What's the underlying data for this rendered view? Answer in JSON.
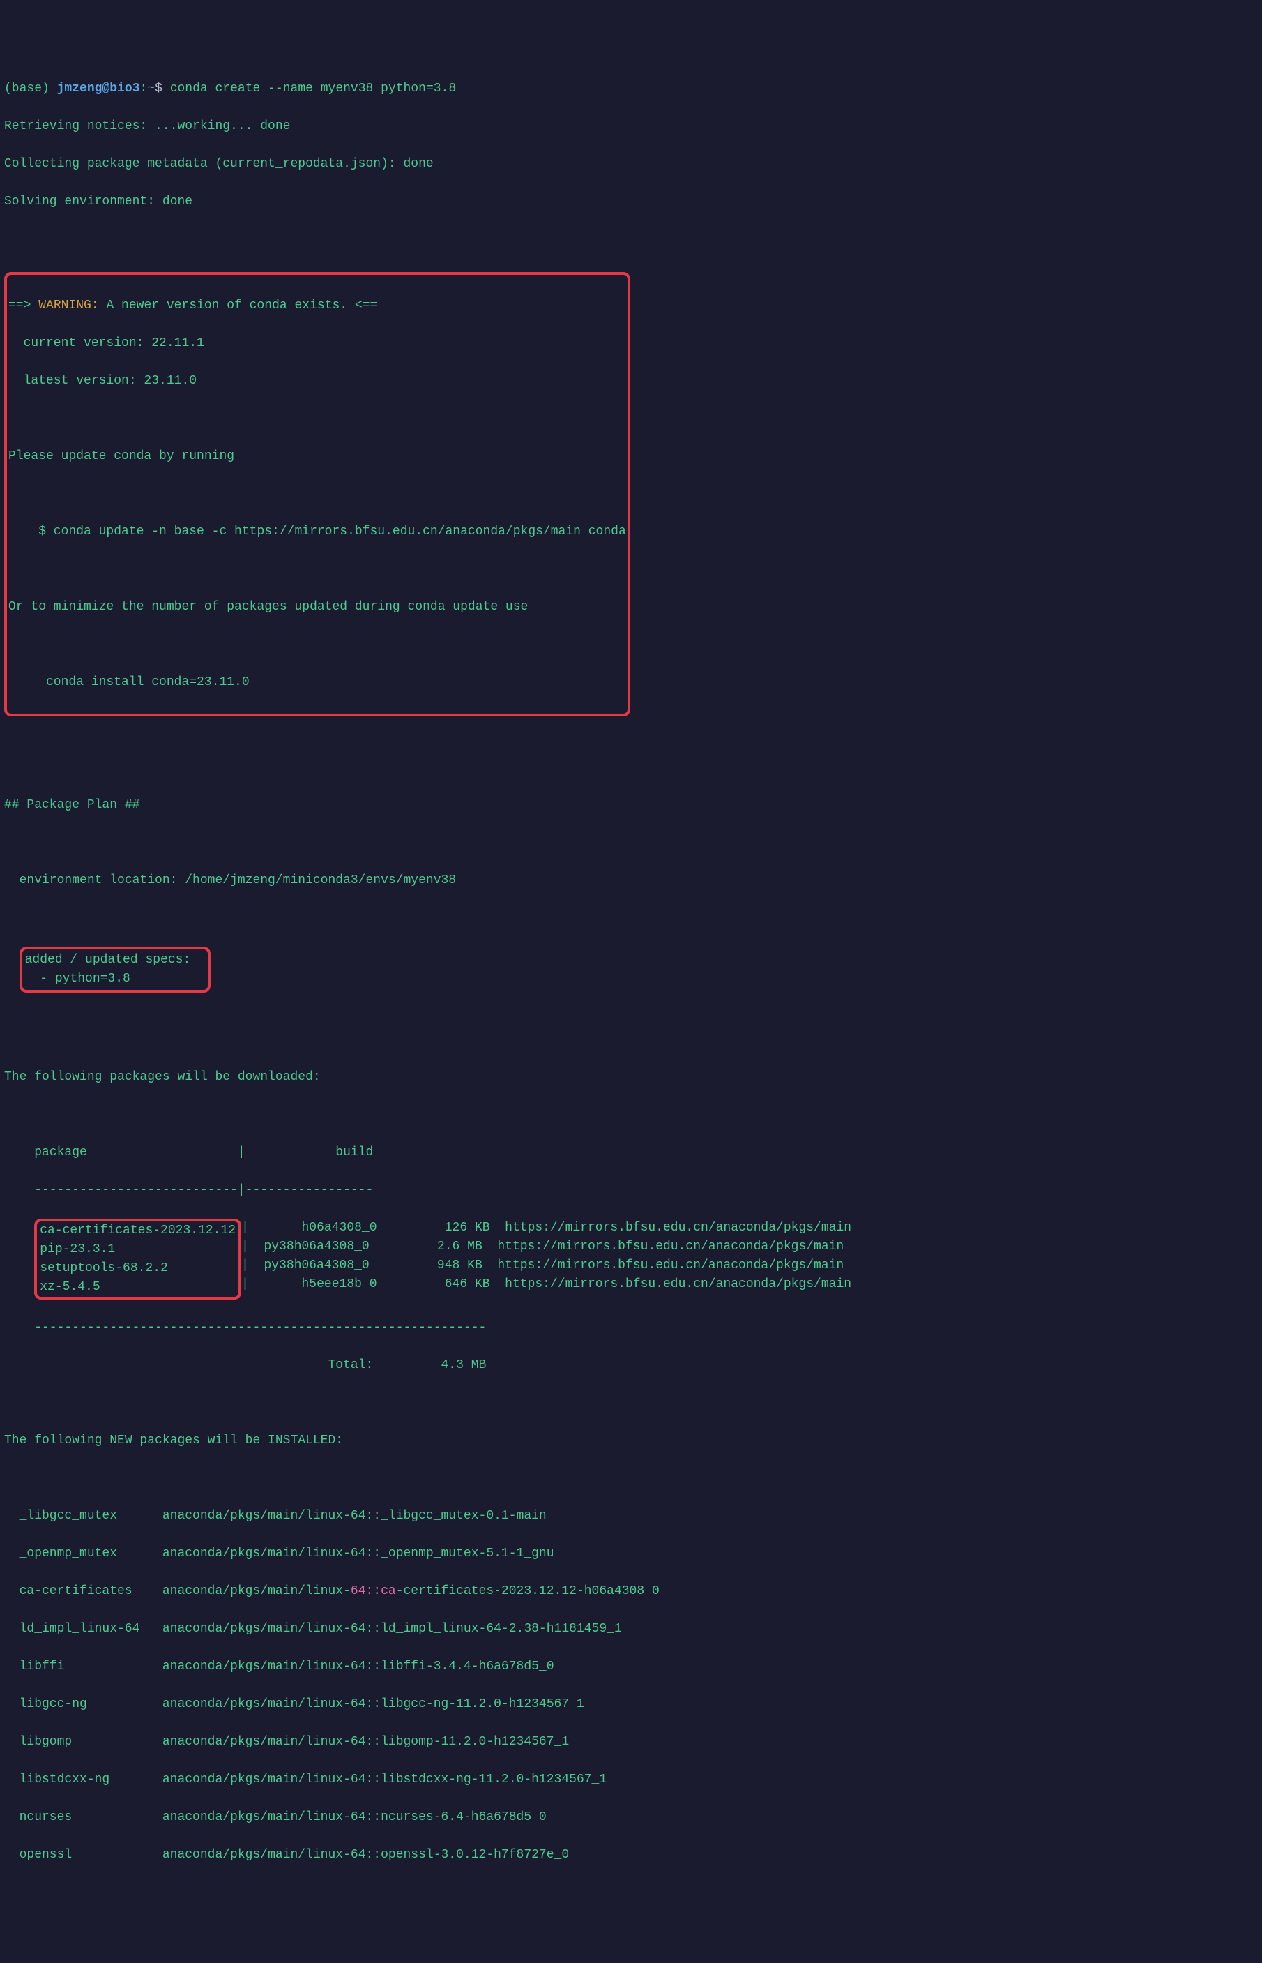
{
  "prompt": {
    "env": "(base) ",
    "userhost": "jmzeng@bio3",
    "sep": ":",
    "tilde": "~",
    "dollar": "$ ",
    "command": "conda create --name myenv38 python=3.8"
  },
  "progress": {
    "line1": "Retrieving notices: ...working... done",
    "line2": "Collecting package metadata (current_repodata.json): done",
    "line3": "Solving environment: done"
  },
  "warning": {
    "arrow_l": "==> ",
    "label": "WARNING:",
    "msg": " A newer version of conda exists. <==",
    "cur": "  current version: 22.11.1",
    "lat": "  latest version: 23.11.0",
    "please": "Please update conda by running",
    "update_cmd": "    $ conda update -n base -c https://mirrors.bfsu.edu.cn/anaconda/pkgs/main conda",
    "or": "Or to minimize the number of packages updated during conda update use",
    "install_cmd": "     conda install conda=23.11.0"
  },
  "plan": {
    "header": "## Package Plan ##",
    "env_loc": "  environment location: /home/jmzeng/miniconda3/envs/myenv38",
    "specs_header": "added / updated specs:",
    "specs_item": "  - python=3.8"
  },
  "download": {
    "intro": "The following packages will be downloaded:",
    "header": "    package                    |            build",
    "rule": "    ---------------------------|-----------------",
    "col_open": "    ",
    "pipe_open": "|",
    "rows": [
      {
        "pkg": "ca-certificates-2023.12.12",
        "build": "       h06a4308_0",
        "size": "         126 KB",
        "url": "  https://mirrors.bfsu.edu.cn/anaconda/pkgs/main"
      },
      {
        "pkg": "pip-23.3.1                ",
        "build": "  py38h06a4308_0",
        "size": "         2.6 MB",
        "url": "  https://mirrors.bfsu.edu.cn/anaconda/pkgs/main"
      },
      {
        "pkg": "setuptools-68.2.2         ",
        "build": "  py38h06a4308_0",
        "size": "         948 KB",
        "url": "  https://mirrors.bfsu.edu.cn/anaconda/pkgs/main"
      },
      {
        "pkg": "xz-5.4.5                  ",
        "build": "       h5eee18b_0",
        "size": "         646 KB",
        "url": "  https://mirrors.bfsu.edu.cn/anaconda/pkgs/main"
      }
    ],
    "rule2": "    ------------------------------------------------------------",
    "total": "                                           Total:         4.3 MB"
  },
  "install": {
    "intro": "The following NEW packages will be INSTALLED:",
    "rows": [
      {
        "name": "  _libgcc_mutex      ",
        "spec_pre": "anaconda/pkgs/main/linux-64::_libgcc_mutex-0.1-main",
        "pink": "",
        "spec_post": ""
      },
      {
        "name": "  _openmp_mutex      ",
        "spec_pre": "anaconda/pkgs/main/linux-64::_openmp_mutex-5.1-1_gnu",
        "pink": "",
        "spec_post": ""
      },
      {
        "name": "  ca-certificates    ",
        "spec_pre": "anaconda/pkgs/main/linux-",
        "pink": "64::ca",
        "spec_post": "-certificates-2023.12.12-h06a4308_0"
      },
      {
        "name": "  ld_impl_linux-64   ",
        "spec_pre": "anaconda/pkgs/main/linux-64::ld_impl_linux-64-2.38-h1181459_1",
        "pink": "",
        "spec_post": ""
      },
      {
        "name": "  libffi             ",
        "spec_pre": "anaconda/pkgs/main/linux-64::libffi-3.4.4-h6a678d5_0",
        "pink": "",
        "spec_post": ""
      },
      {
        "name": "  libgcc-ng          ",
        "spec_pre": "anaconda/pkgs/main/linux-64::libgcc-ng-11.2.0-h1234567_1",
        "pink": "",
        "spec_post": ""
      },
      {
        "name": "  libgomp            ",
        "spec_pre": "anaconda/pkgs/main/linux-64::libgomp-11.2.0-h1234567_1",
        "pink": "",
        "spec_post": ""
      },
      {
        "name": "  libstdcxx-ng       ",
        "spec_pre": "anaconda/pkgs/main/linux-64::libstdcxx-ng-11.2.0-h1234567_1",
        "pink": "",
        "spec_post": ""
      },
      {
        "name": "  ncurses            ",
        "spec_pre": "anaconda/pkgs/main/linux-64::ncurses-6.4-h6a678d5_0",
        "pink": "",
        "spec_post": ""
      },
      {
        "name": "  openssl            ",
        "spec_pre": "anaconda/pkgs/main/linux-64::openssl-3.0.12-h7f8727e_0",
        "pink": "",
        "spec_post": ""
      }
    ]
  }
}
